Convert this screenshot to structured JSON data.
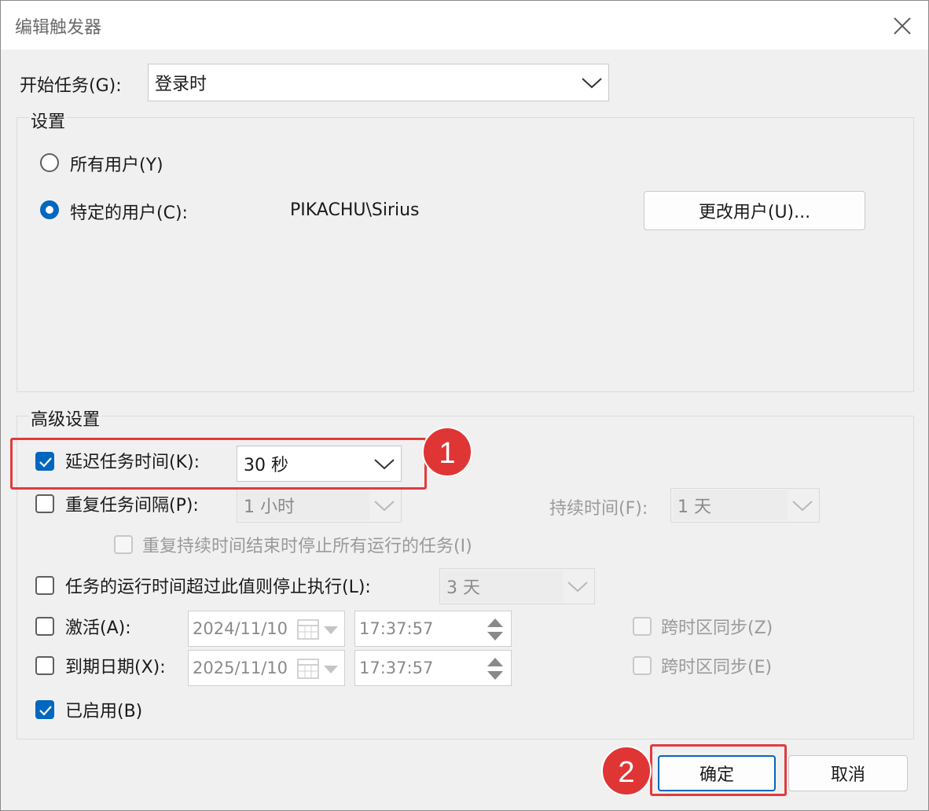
{
  "window": {
    "title": "编辑触发器"
  },
  "begin_task": {
    "label": "开始任务(G):",
    "value": "登录时"
  },
  "settings_group": {
    "title": "设置",
    "all_users_label": "所有用户(Y)",
    "specific_user_label": "特定的用户(C):",
    "user_name": "PIKACHU\\Sirius",
    "change_user_label": "更改用户(U)...",
    "selected": "specific_user"
  },
  "advanced": {
    "title": "高级设置",
    "delay": {
      "label": "延迟任务时间(K):",
      "checked": true,
      "value": "30 秒"
    },
    "repeat": {
      "label": "重复任务间隔(P):",
      "checked": false,
      "value": "1 小时",
      "duration_label": "持续时间(F):",
      "duration_value": "1 天"
    },
    "stop_all": {
      "label": "重复持续时间结束时停止所有运行的任务(I)",
      "checked": false
    },
    "stop_if_longer": {
      "label": "任务的运行时间超过此值则停止执行(L):",
      "checked": false,
      "value": "3 天"
    },
    "activate": {
      "label": "激活(A):",
      "checked": false,
      "date": "2024/11/10",
      "time": "17:37:57",
      "sync_label": "跨时区同步(Z)"
    },
    "expire": {
      "label": "到期日期(X):",
      "checked": false,
      "date": "2025/11/10",
      "time": "17:37:57",
      "sync_label": "跨时区同步(E)"
    },
    "enabled": {
      "label": "已启用(B)",
      "checked": true
    }
  },
  "buttons": {
    "ok": "确定",
    "cancel": "取消"
  },
  "annotations": {
    "badge1": "1",
    "badge2": "2"
  },
  "colors": {
    "accent": "#0067c0",
    "annotation": "#e03535"
  }
}
